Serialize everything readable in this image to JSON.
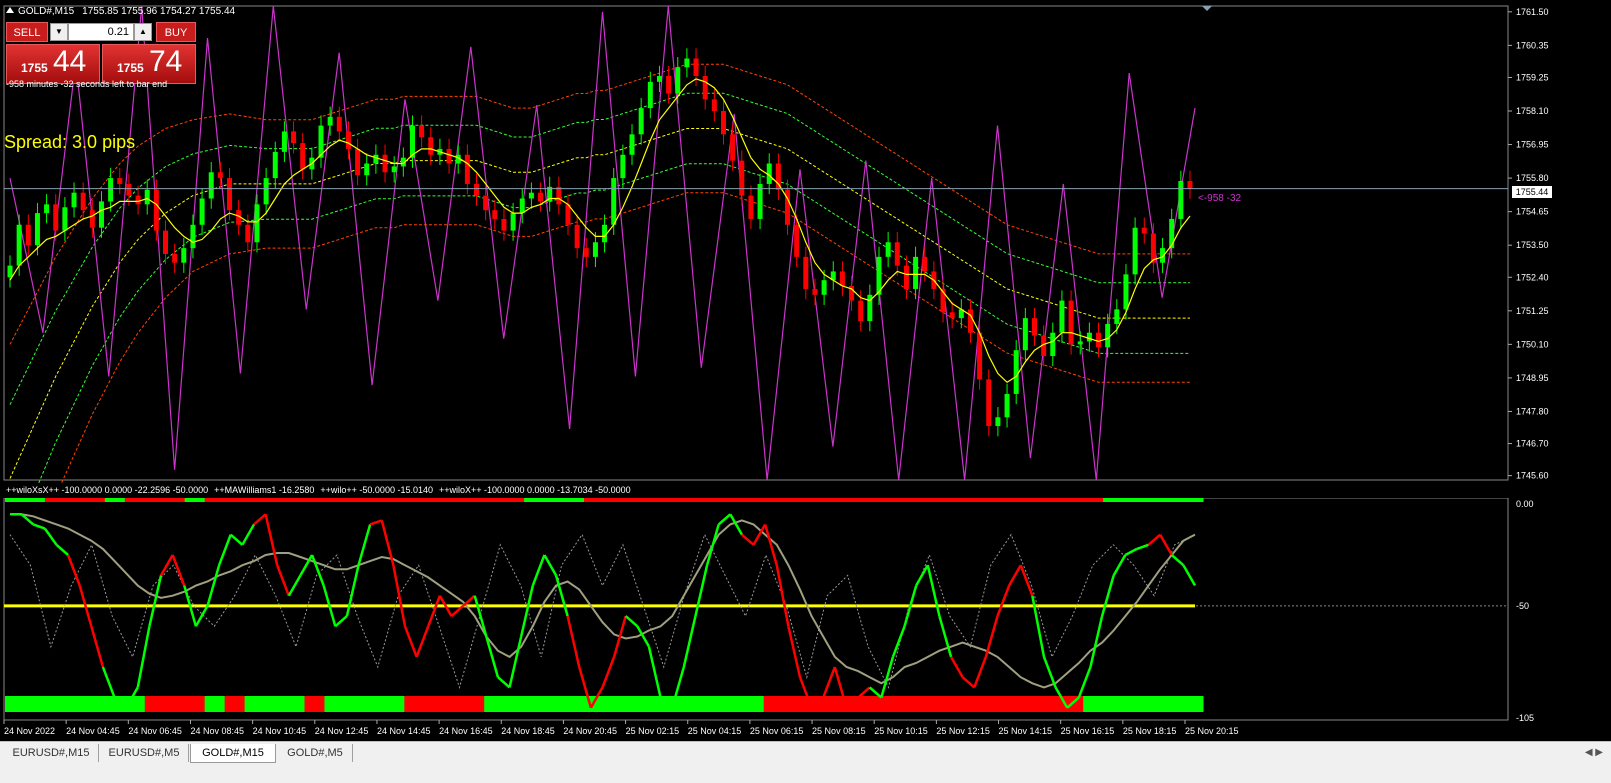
{
  "header": {
    "symbol": "GOLD#,M15",
    "ohlc": "1755.85 1755.96 1754.27 1755.44"
  },
  "trade_panel": {
    "sell_label": "SELL",
    "buy_label": "BUY",
    "lot_size": "0.21",
    "sell_price_small": "1755",
    "sell_price_big": "44",
    "buy_price_small": "1755",
    "buy_price_big": "74",
    "timer": "-958 minutes -32 seconds left to bar end"
  },
  "spread_label": "Spread: 3.0 pips",
  "current_price": "1755.44",
  "countdown": "<-958 -32",
  "price_axis": [
    "1761.50",
    "1760.35",
    "1759.25",
    "1758.10",
    "1756.95",
    "1755.80",
    "1754.65",
    "1753.50",
    "1752.40",
    "1751.25",
    "1750.10",
    "1748.95",
    "1747.80",
    "1746.70",
    "1745.60"
  ],
  "indicator_axis": [
    "0.00",
    "-50",
    "-105"
  ],
  "indicator_legend": [
    "++wiloXsX++ -100.0000 0.0000 -22.2596 -50.0000",
    "++MAWilliams1 -16.2580",
    "++wilo++ -50.0000 -15.0140",
    "++wiloX++ -100.0000 0.0000 -13.7034 -50.0000"
  ],
  "time_axis": [
    "24 Nov 2022",
    "24 Nov 04:45",
    "24 Nov 06:45",
    "24 Nov 08:45",
    "24 Nov 10:45",
    "24 Nov 12:45",
    "24 Nov 14:45",
    "24 Nov 16:45",
    "24 Nov 18:45",
    "24 Nov 20:45",
    "25 Nov 02:15",
    "25 Nov 04:15",
    "25 Nov 06:15",
    "25 Nov 08:15",
    "25 Nov 10:15",
    "25 Nov 12:15",
    "25 Nov 14:15",
    "25 Nov 16:15",
    "25 Nov 18:15",
    "25 Nov 20:15"
  ],
  "tabs": [
    {
      "label": "EURUSD#,M15",
      "active": false
    },
    {
      "label": "EURUSD#,M5",
      "active": false
    },
    {
      "label": "GOLD#,M15",
      "active": true
    },
    {
      "label": "GOLD#,M5",
      "active": false
    }
  ],
  "colors": {
    "bull": "#00ff00",
    "bear": "#ff0000",
    "ma": "#ffff00",
    "oscillator": "#cc33cc",
    "band_outer": "#ff4400",
    "band_inner": "#33ff33",
    "band_mid": "#ffff00",
    "bid_line": "#8aa0b0",
    "trend_gray": "#a0a080"
  },
  "chart_data": {
    "type": "candlestick",
    "price_range": [
      1745.45,
      1761.7
    ],
    "indicator_range": [
      -106,
      2
    ],
    "indicator_level": -50,
    "closes": [
      1752.8,
      1754.2,
      1753.5,
      1754.6,
      1754.9,
      1754.0,
      1754.8,
      1755.3,
      1754.7,
      1754.1,
      1755.0,
      1755.8,
      1755.6,
      1755.2,
      1754.9,
      1755.4,
      1754.0,
      1753.2,
      1752.9,
      1753.4,
      1754.2,
      1755.1,
      1756.0,
      1755.8,
      1754.7,
      1754.2,
      1753.6,
      1754.9,
      1755.8,
      1756.7,
      1757.4,
      1757.0,
      1756.1,
      1756.5,
      1757.6,
      1757.9,
      1757.4,
      1756.8,
      1755.9,
      1756.3,
      1756.6,
      1756.0,
      1756.2,
      1756.5,
      1757.6,
      1757.2,
      1756.6,
      1756.8,
      1756.3,
      1756.6,
      1755.6,
      1755.2,
      1754.7,
      1754.4,
      1754.0,
      1754.6,
      1755.1,
      1755.3,
      1755.0,
      1755.5,
      1754.9,
      1754.2,
      1753.4,
      1753.1,
      1753.6,
      1754.2,
      1755.8,
      1756.6,
      1757.3,
      1758.2,
      1759.1,
      1759.3,
      1758.7,
      1759.6,
      1759.9,
      1759.3,
      1758.5,
      1758.1,
      1757.3,
      1756.4,
      1755.2,
      1754.4,
      1755.6,
      1756.3,
      1755.4,
      1754.2,
      1753.1,
      1752.0,
      1751.8,
      1752.3,
      1752.6,
      1752.1,
      1751.6,
      1750.9,
      1751.8,
      1753.1,
      1753.6,
      1752.8,
      1752.0,
      1753.1,
      1752.6,
      1752.0,
      1751.2,
      1751.0,
      1751.3,
      1750.5,
      1748.9,
      1747.3,
      1747.6,
      1748.4,
      1749.9,
      1751.0,
      1750.4,
      1749.7,
      1750.5,
      1751.6,
      1750.1,
      1750.2,
      1750.5,
      1750.0,
      1750.8,
      1751.3,
      1752.5,
      1754.1,
      1753.9,
      1752.9,
      1753.4,
      1754.4,
      1755.7,
      1755.44
    ],
    "sma": [
      1752.3,
      1752.8,
      1753.1,
      1753.4,
      1753.7,
      1753.8,
      1754.0,
      1754.2,
      1754.4,
      1754.5,
      1754.7,
      1754.8,
      1755.0,
      1755.0,
      1755.0,
      1755.1,
      1754.9,
      1754.5,
      1754.1,
      1753.8,
      1753.6,
      1753.7,
      1754.0,
      1754.4,
      1754.6,
      1754.5,
      1754.3,
      1754.3,
      1754.6,
      1755.1,
      1755.6,
      1755.9,
      1756.1,
      1756.3,
      1756.6,
      1756.9,
      1757.1,
      1757.0,
      1756.8,
      1756.6,
      1756.5,
      1756.4,
      1756.3,
      1756.3,
      1756.6,
      1756.8,
      1756.8,
      1756.7,
      1756.6,
      1756.5,
      1756.3,
      1756.0,
      1755.6,
      1755.2,
      1754.8,
      1754.6,
      1754.6,
      1754.8,
      1754.9,
      1755.1,
      1755.1,
      1754.9,
      1754.5,
      1754.1,
      1753.8,
      1753.8,
      1754.2,
      1754.8,
      1755.5,
      1756.3,
      1757.1,
      1757.8,
      1758.2,
      1758.6,
      1759.0,
      1759.2,
      1759.1,
      1758.9,
      1758.5,
      1757.9,
      1757.2,
      1756.5,
      1756.1,
      1755.9,
      1755.6,
      1755.1,
      1754.4,
      1753.6,
      1752.9,
      1752.5,
      1752.3,
      1752.1,
      1752.0,
      1751.7,
      1751.6,
      1751.9,
      1752.3,
      1752.6,
      1752.5,
      1752.5,
      1752.5,
      1752.3,
      1751.9,
      1751.5,
      1751.3,
      1751.1,
      1750.5,
      1749.7,
      1749.1,
      1748.8,
      1749.0,
      1749.5,
      1749.9,
      1750.1,
      1750.2,
      1750.5,
      1750.5,
      1750.4,
      1750.3,
      1750.2,
      1750.3,
      1750.6,
      1751.2,
      1752.0,
      1752.7,
      1753.0,
      1753.1,
      1753.5,
      1754.1,
      1754.5
    ],
    "band_mid": [
      1745.5,
      1746.2,
      1746.9,
      1747.6,
      1748.3,
      1749.0,
      1749.6,
      1750.2,
      1750.8,
      1751.4,
      1751.9,
      1752.4,
      1752.9,
      1753.3,
      1753.7,
      1754.0,
      1754.3,
      1754.6,
      1754.8,
      1755.0,
      1755.2,
      1755.3,
      1755.4,
      1755.5,
      1755.6,
      1755.6,
      1755.6,
      1755.6,
      1755.6,
      1755.6,
      1755.6,
      1755.6,
      1755.6,
      1755.6,
      1755.7,
      1755.8,
      1755.9,
      1756.0,
      1756.1,
      1756.2,
      1756.3,
      1756.3,
      1756.3,
      1756.4,
      1756.4,
      1756.4,
      1756.4,
      1756.4,
      1756.4,
      1756.4,
      1756.4,
      1756.4,
      1756.3,
      1756.2,
      1756.1,
      1756.0,
      1756.0,
      1756.0,
      1756.1,
      1756.2,
      1756.3,
      1756.4,
      1756.5,
      1756.5,
      1756.6,
      1756.6,
      1756.7,
      1756.8,
      1756.9,
      1757.0,
      1757.1,
      1757.2,
      1757.3,
      1757.4,
      1757.5,
      1757.5,
      1757.5,
      1757.5,
      1757.5,
      1757.4,
      1757.3,
      1757.2,
      1757.1,
      1757.0,
      1756.9,
      1756.8,
      1756.6,
      1756.4,
      1756.2,
      1756.0,
      1755.8,
      1755.6,
      1755.4,
      1755.2,
      1755.0,
      1754.8,
      1754.6,
      1754.4,
      1754.2,
      1754.0,
      1753.8,
      1753.6,
      1753.4,
      1753.2,
      1753.0,
      1752.8,
      1752.6,
      1752.4,
      1752.2,
      1752.0,
      1751.9,
      1751.8,
      1751.7,
      1751.6,
      1751.5,
      1751.4,
      1751.3,
      1751.2,
      1751.1,
      1751.0,
      1751.0,
      1751.0,
      1751.0,
      1751.0,
      1751.0,
      1751.0,
      1751.0,
      1751.0,
      1751.0,
      1751.0
    ],
    "band_width": [
      4.6,
      4.5,
      4.4,
      4.3,
      4.2,
      4.1,
      4.0,
      3.9,
      3.8,
      3.7,
      3.6,
      3.5,
      3.4,
      3.3,
      3.2,
      3.1,
      3.0,
      2.9,
      2.8,
      2.7,
      2.6,
      2.55,
      2.5,
      2.45,
      2.4,
      2.35,
      2.3,
      2.25,
      2.2,
      2.2,
      2.2,
      2.2,
      2.2,
      2.2,
      2.2,
      2.2,
      2.2,
      2.2,
      2.2,
      2.2,
      2.2,
      2.2,
      2.2,
      2.2,
      2.2,
      2.2,
      2.2,
      2.2,
      2.2,
      2.2,
      2.2,
      2.2,
      2.2,
      2.2,
      2.2,
      2.2,
      2.2,
      2.2,
      2.2,
      2.2,
      2.2,
      2.2,
      2.2,
      2.2,
      2.2,
      2.2,
      2.2,
      2.2,
      2.2,
      2.2,
      2.2,
      2.2,
      2.2,
      2.2,
      2.2,
      2.2,
      2.2,
      2.2,
      2.2,
      2.2,
      2.2,
      2.2,
      2.2,
      2.2,
      2.2,
      2.2,
      2.2,
      2.2,
      2.2,
      2.2,
      2.2,
      2.2,
      2.2,
      2.2,
      2.2,
      2.2,
      2.2,
      2.2,
      2.2,
      2.2,
      2.2,
      2.2,
      2.2,
      2.2,
      2.2,
      2.2,
      2.2,
      2.2,
      2.2,
      2.2,
      2.2,
      2.2,
      2.2,
      2.2,
      2.2,
      2.2,
      2.2,
      2.2,
      2.2,
      2.2,
      2.2,
      2.2,
      2.2,
      2.2,
      2.2,
      2.2,
      2.2,
      2.2,
      2.2,
      2.2
    ],
    "oscillator_peaks": [
      1755.8,
      1750.5,
      1759.8,
      1749.0,
      1761.7,
      1745.8,
      1760.6,
      1749.1,
      1761.7,
      1751.3,
      1760.1,
      1748.7,
      1758.5,
      1751.6,
      1760.3,
      1750.3,
      1758.3,
      1747.2,
      1761.5,
      1749.0,
      1761.7,
      1749.3,
      1758.0,
      1745.3,
      1756.1,
      1746.6,
      1756.4,
      1744.8,
      1755.8,
      1744.4,
      1757.6,
      1746.2,
      1755.6,
      1745.4,
      1759.4,
      1751.7,
      1758.2
    ],
    "wpr_fast": [
      -5,
      -5,
      -10,
      -12,
      -20,
      -25,
      -40,
      -60,
      -80,
      -95,
      -100,
      -90,
      -60,
      -35,
      -25,
      -40,
      -60,
      -50,
      -30,
      -15,
      -20,
      -10,
      -5,
      -30,
      -45,
      -35,
      -25,
      -40,
      -60,
      -55,
      -30,
      -10,
      -8,
      -30,
      -60,
      -75,
      -60,
      -45,
      -55,
      -50,
      -45,
      -65,
      -85,
      -90,
      -65,
      -40,
      -25,
      -35,
      -55,
      -80,
      -100,
      -90,
      -75,
      -55,
      -60,
      -70,
      -95,
      -100,
      -80,
      -55,
      -30,
      -10,
      -5,
      -15,
      -20,
      -10,
      -30,
      -60,
      -85,
      -100,
      -95,
      -80,
      -100,
      -95,
      -90,
      -95,
      -75,
      -60,
      -40,
      -30,
      -55,
      -75,
      -85,
      -90,
      -75,
      -55,
      -40,
      -30,
      -45,
      -75,
      -90,
      -100,
      -95,
      -80,
      -55,
      -35,
      -25,
      -22,
      -20,
      -15,
      -25,
      -30,
      -40
    ],
    "ma_williams": [
      -5,
      -5,
      -6,
      -8,
      -10,
      -12,
      -15,
      -18,
      -22,
      -28,
      -34,
      -40,
      -44,
      -46,
      -45,
      -43,
      -40,
      -38,
      -35,
      -33,
      -30,
      -28,
      -25,
      -24,
      -24,
      -26,
      -28,
      -30,
      -32,
      -32,
      -30,
      -28,
      -26,
      -27,
      -30,
      -33,
      -36,
      -40,
      -44,
      -48,
      -55,
      -65,
      -72,
      -75,
      -70,
      -60,
      -48,
      -40,
      -38,
      -42,
      -50,
      -58,
      -64,
      -66,
      -65,
      -62,
      -60,
      -55,
      -45,
      -35,
      -25,
      -15,
      -10,
      -8,
      -10,
      -15,
      -20,
      -30,
      -42,
      -55,
      -65,
      -75,
      -80,
      -82,
      -85,
      -88,
      -85,
      -80,
      -78,
      -75,
      -72,
      -70,
      -68,
      -70,
      -72,
      -75,
      -80,
      -85,
      -88,
      -90,
      -88,
      -83,
      -78,
      -72,
      -68,
      -62,
      -55,
      -48,
      -40,
      -32,
      -25,
      -18,
      -15
    ],
    "wilo_dots": [
      -15,
      -30,
      -70,
      -40,
      -20,
      -55,
      -75,
      -40,
      -30,
      -50,
      -60,
      -45,
      -25,
      -45,
      -70,
      -35,
      -25,
      -55,
      -80,
      -45,
      -30,
      -60,
      -90,
      -55,
      -20,
      -40,
      -75,
      -30,
      -15,
      -40,
      -20,
      -50,
      -80,
      -45,
      -15,
      -35,
      -55,
      -25,
      -50,
      -85,
      -45,
      -35,
      -70,
      -90,
      -50,
      -25,
      -55,
      -70,
      -30,
      -15,
      -40,
      -75,
      -55,
      -30,
      -20,
      -30,
      -45,
      -20,
      -15
    ],
    "top_band": [
      1,
      1,
      0,
      0,
      0,
      1,
      0,
      0,
      0,
      1,
      0,
      0,
      0,
      0,
      0,
      0,
      0,
      0,
      0,
      0,
      0,
      0,
      0,
      0,
      0,
      0,
      1,
      1,
      1,
      0,
      0,
      0,
      0,
      0,
      0,
      0,
      0,
      0,
      0,
      0,
      0,
      0,
      0,
      0,
      0,
      0,
      0,
      0,
      0,
      0,
      0,
      0,
      0,
      0,
      0,
      1,
      1,
      1,
      1,
      1
    ],
    "bottom_band": [
      1,
      1,
      1,
      1,
      1,
      1,
      1,
      0,
      0,
      0,
      1,
      0,
      1,
      1,
      1,
      0,
      1,
      1,
      1,
      1,
      0,
      0,
      0,
      0,
      1,
      1,
      1,
      1,
      1,
      1,
      1,
      1,
      1,
      1,
      1,
      1,
      1,
      1,
      0,
      0,
      0,
      0,
      0,
      0,
      0,
      0,
      0,
      0,
      0,
      0,
      0,
      0,
      0,
      0,
      1,
      1,
      1,
      1,
      1,
      1
    ],
    "wilo_line_color": [
      1,
      1,
      1,
      1,
      1,
      1,
      0,
      0,
      0,
      1,
      1,
      1,
      1,
      1,
      0,
      0,
      1,
      1,
      1,
      1,
      1,
      1,
      0,
      0,
      0,
      1,
      1,
      1,
      1,
      1,
      1,
      1,
      0,
      0,
      0,
      0,
      0,
      0,
      0,
      0,
      0,
      1,
      1,
      1,
      1,
      1,
      1,
      1,
      1,
      0,
      0,
      0,
      0,
      0,
      1,
      1,
      1,
      1,
      1,
      1,
      1,
      1,
      1,
      1,
      0,
      0,
      0,
      0,
      0,
      0,
      0,
      0,
      0,
      0,
      0,
      1,
      1,
      1,
      1,
      1,
      1,
      1,
      0,
      0,
      0,
      0,
      0,
      0,
      0,
      1,
      1,
      1,
      1,
      1,
      1,
      1,
      1,
      1,
      1,
      0,
      0,
      1,
      1
    ]
  }
}
